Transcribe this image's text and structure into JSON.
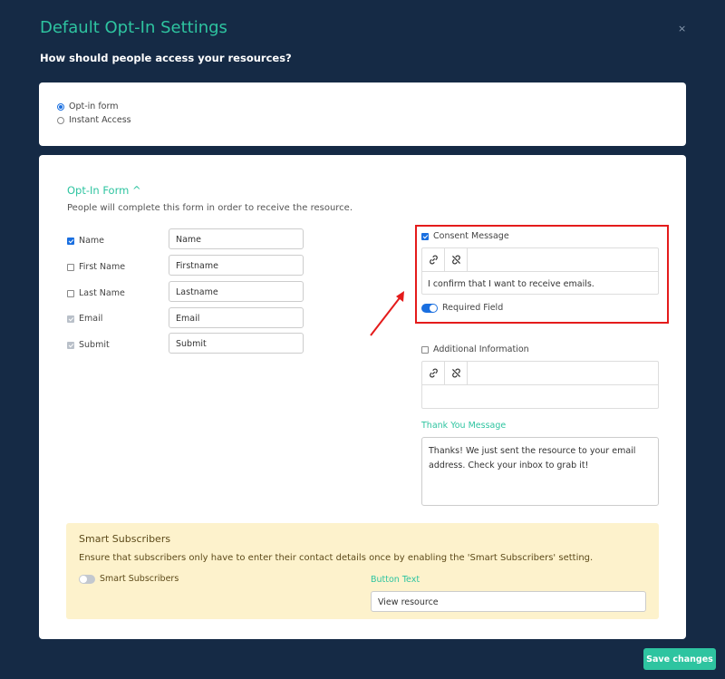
{
  "header": {
    "title": "Default Opt-In Settings",
    "subtitle": "How should people access your resources?",
    "close_label": "×"
  },
  "access": {
    "options": [
      {
        "label": "Opt-in form",
        "selected": true
      },
      {
        "label": "Instant Access",
        "selected": false
      }
    ]
  },
  "optin": {
    "heading": "Opt-In Form ^",
    "description": "People will complete this form in order to receive the resource.",
    "fields": [
      {
        "label": "Name",
        "value": "Name",
        "checked": true,
        "disabled": false
      },
      {
        "label": "First Name",
        "value": "Firstname",
        "checked": false,
        "disabled": false
      },
      {
        "label": "Last Name",
        "value": "Lastname",
        "checked": false,
        "disabled": false
      },
      {
        "label": "Email",
        "value": "Email",
        "checked": true,
        "disabled": true
      },
      {
        "label": "Submit",
        "value": "Submit",
        "checked": true,
        "disabled": true
      }
    ]
  },
  "consent": {
    "label": "Consent Message",
    "checked": true,
    "text": "I confirm that I want to receive emails.",
    "required_label": "Required Field",
    "required_on": true
  },
  "additional": {
    "label": "Additional Information",
    "checked": false,
    "text": ""
  },
  "thanks": {
    "label": "Thank You Message",
    "text": "Thanks! We just sent the resource to your email address. Check your inbox to grab it!"
  },
  "smart": {
    "title": "Smart Subscribers",
    "description": "Ensure that subscribers only have to enter their contact details once by enabling the 'Smart Subscribers' setting.",
    "toggle_label": "Smart Subscribers",
    "toggle_on": false,
    "button_text_label": "Button Text",
    "button_text_value": "View resource"
  },
  "footer": {
    "save_label": "Save changes"
  },
  "colors": {
    "background": "#152a45",
    "accent": "#2ec4a0",
    "highlight": "#e41b1b",
    "toggle_on": "#1a6fe0",
    "smart_bg": "#fdf2cc"
  },
  "icons": [
    "link-icon",
    "unlink-icon",
    "close-icon",
    "chevron-up-icon",
    "arrow-annotation-icon"
  ]
}
